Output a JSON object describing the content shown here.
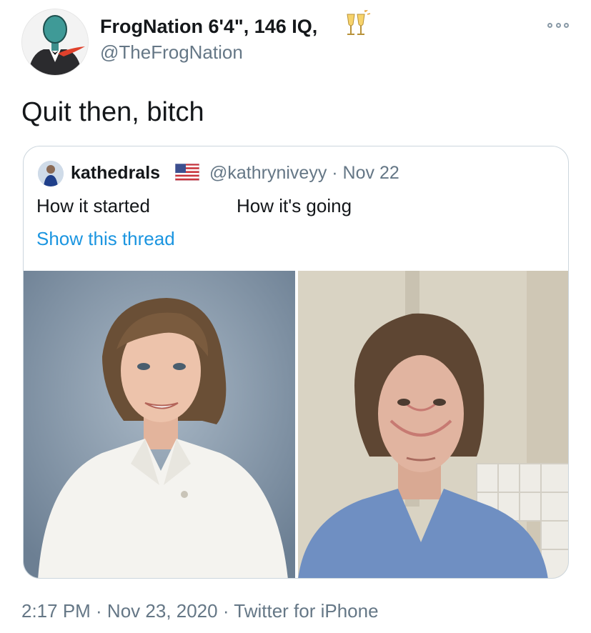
{
  "author": {
    "display_name": "FrogNation 6'4\", 146 IQ,",
    "handle": "@TheFrogNation",
    "name_emoji": "clinking-glasses-icon",
    "avatar_icon": "frog-suit-avatar-icon"
  },
  "tweet": {
    "text": "Quit then, bitch"
  },
  "quoted": {
    "name": "kathedrals",
    "flag_icon": "us-flag-icon",
    "meta": "@kathryniveyy · Nov 22",
    "text_left": "How it started",
    "text_right": "How it's going",
    "thread_link": "Show this thread",
    "images": [
      {
        "name": "how-it-started-photo"
      },
      {
        "name": "how-its-going-photo"
      }
    ]
  },
  "footer": {
    "time_date": "2:17 PM · Nov 23, 2020 · ",
    "source": "Twitter for iPhone"
  },
  "colors": {
    "text": "#14171a",
    "secondary": "#657786",
    "link": "#1b95e0",
    "border": "#ccd6dd"
  }
}
